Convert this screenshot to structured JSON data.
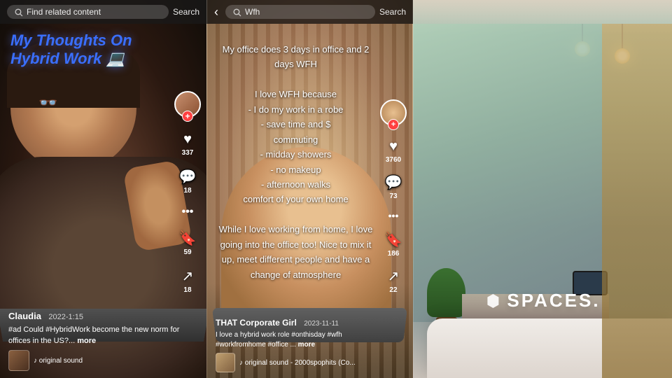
{
  "panels": {
    "left": {
      "search_placeholder": "Find related content",
      "search_button": "Search",
      "title_line1": "My Thoughts On",
      "title_line2": "Hybrid Work",
      "title_emoji": "💻",
      "username": "Claudia",
      "year": "2022-1:15",
      "caption": "#ad Could #HybridWork become the new norm for offices in the US?...",
      "caption_more": "more",
      "like_count": "337",
      "comment_count": "18",
      "share_count": "18",
      "bookmark_count": "59",
      "music_text": "♪ original sound"
    },
    "middle": {
      "search_placeholder": "Wfh",
      "search_button": "Search",
      "overlay_text_1": "My office does 3 days in office and 2 days WFH",
      "overlay_text_2": "I love WFH because",
      "overlay_text_3": "- I do my work in a robe",
      "overlay_text_4": "- save time and $",
      "overlay_text_5": "commuting",
      "overlay_text_6": "- midday showers",
      "overlay_text_7": "- no makeup",
      "overlay_text_8": "- afternoon walks",
      "overlay_text_9": "comfort of your own home",
      "overlay_text_10": "While I love working from home, I love going into the office too! Nice to mix it up, meet different people and have a change of atmosphere",
      "username": "THAT Corporate Girl",
      "year": "2023-11-11",
      "caption": "I love a hybrid work role #onthisday #wfh #workfromhome #office ...",
      "caption_more": "more",
      "music": "♪ original sound - 2000spophits (Co...",
      "like_count": "3760",
      "comment_count": "73",
      "share_count": "22",
      "bookmark_count": "186"
    },
    "right": {
      "spaces_logo": "SPACES."
    }
  },
  "icons": {
    "back": "‹",
    "search": "🔍",
    "heart": "♥",
    "comment": "💬",
    "bookmark": "🔖",
    "share": "↗",
    "more": "•••",
    "music_note": "♪",
    "spaces_hex": "⬡"
  },
  "colors": {
    "accent_blue": "#3a6fff",
    "tiktok_red": "#ff2d55",
    "plus_red": "#ff4040",
    "panel_bg_left": "#1a0e08",
    "panel_bg_mid": "#3a2510",
    "panel_bg_right": "#c0b8b0"
  }
}
